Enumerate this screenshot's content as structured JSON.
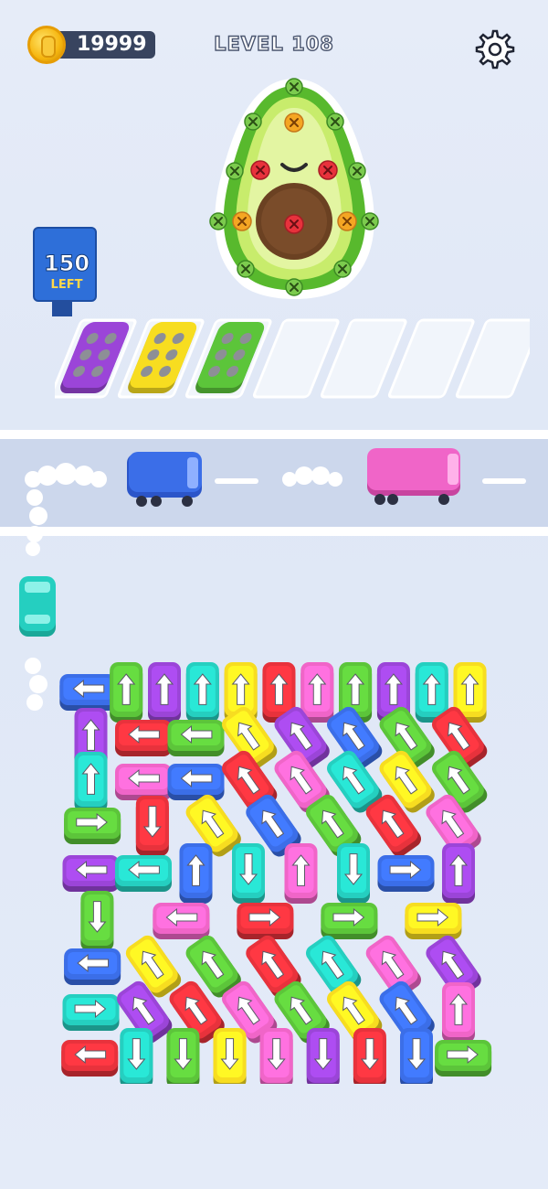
{
  "header": {
    "coins": "19999",
    "level": "LEVEL 108"
  },
  "counter": {
    "number": "150",
    "label": "LEFT"
  },
  "colors": {
    "red": "#e8323c",
    "green": "#5cc53a",
    "blue": "#3b6ee8",
    "yellow": "#f7dd20",
    "purple": "#9b45d8",
    "pink": "#f065c8",
    "teal": "#25cfc0"
  },
  "slots": [
    {
      "filled": true,
      "color": "purple"
    },
    {
      "filled": true,
      "color": "yellow"
    },
    {
      "filled": true,
      "color": "green"
    },
    {
      "filled": false
    },
    {
      "filled": false
    },
    {
      "filled": false
    },
    {
      "filled": false
    }
  ],
  "road_buses": [
    {
      "color": "blue"
    },
    {
      "color": "pink"
    }
  ],
  "waiting_car": {
    "color": "teal"
  },
  "parking_lot": {
    "description_rows": [
      [
        "blue-left",
        "green-up",
        "purple-up",
        "teal-up",
        "yellow-up",
        "red-up",
        "pink-up",
        "green-up",
        "purple-up",
        "teal-up",
        "yellow-up"
      ],
      [
        "purple-up",
        "red-left",
        "green-left",
        "yellow-diag",
        "purple-diag",
        "blue-diag",
        "green-diag",
        "red-diag"
      ],
      [
        "teal-up",
        "pink-left",
        "blue-left",
        "red-diag",
        "pink-diag",
        "teal-diag",
        "yellow-diag",
        "green-diag"
      ],
      [
        "green-right",
        "red-down",
        "yellow-diag",
        "blue-diag",
        "green-diag",
        "red-diag",
        "pink-diag"
      ],
      [
        "purple-left",
        "teal-left",
        "blue-up",
        "teal-down",
        "pink-up",
        "teal-down",
        "blue-right",
        "purple-up"
      ],
      [
        "green-down",
        "pink-left",
        "red-right",
        "green-right",
        "yellow-right"
      ],
      [
        "blue-left",
        "yellow-diag",
        "green-diag",
        "red-diag",
        "teal-diag",
        "pink-diag",
        "purple-diag"
      ],
      [
        "teal-right",
        "purple-diag",
        "red-diag",
        "pink-diag",
        "green-diag",
        "yellow-diag",
        "blue-diag",
        "pink-up"
      ],
      [
        "red-left",
        "teal-down",
        "green-down",
        "yellow-down",
        "pink-down",
        "purple-down",
        "red-down",
        "blue-down",
        "green-right"
      ]
    ]
  }
}
